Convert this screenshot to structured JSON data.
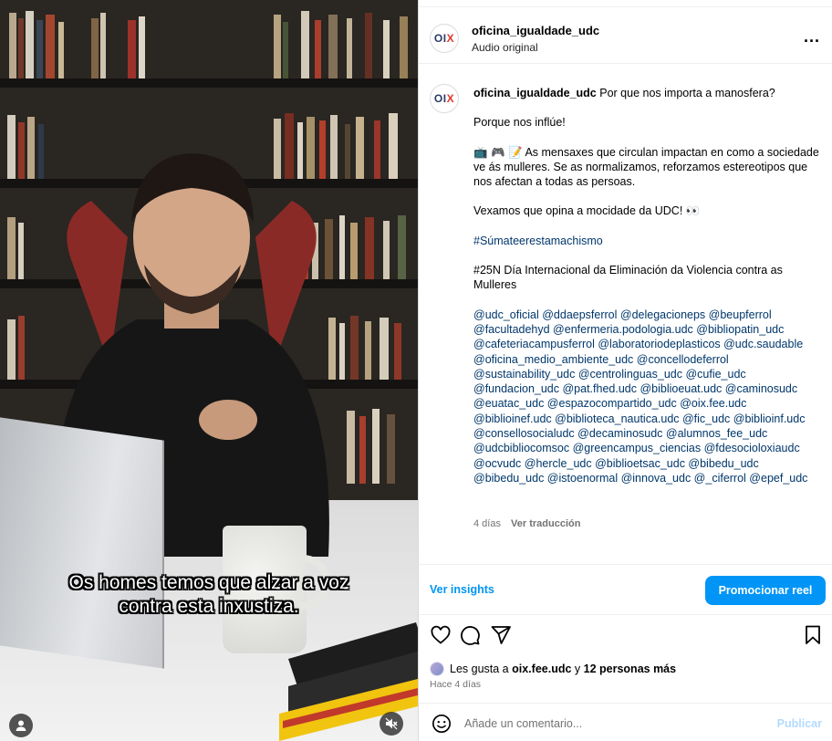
{
  "video": {
    "subtitle_lines": [
      "Os homes temos que alzar a voz",
      "contra esta inxustiza."
    ]
  },
  "post": {
    "username": "oficina_igualdade_udc",
    "audio_label": "Audio original",
    "avatar_text": "OIX",
    "more_label": "...",
    "caption": {
      "username": "oficina_igualdade_udc",
      "first_line": "Por que nos importa a manosfera?",
      "p2": "Porque nos inflúe!",
      "p3_emojis": "📺 🎮 📝",
      "p3": "As mensaxes que circulan impactan en como a sociedade ve ás mulleres. Se as normalizamos, reforzamos estereotipos que nos afectan a todas as persoas.",
      "p4": "Vexamos que opina a mocidade da UDC! 👀",
      "hashtag": "#Súmateerestamachismo",
      "p6": "#25N Día Internacional da Eliminación da Violencia contra as Mulleres",
      "mentions": "@udc_oficial @ddaepsferrol @delegacioneps @beupferrol @facultadehyd @enfermeria.podologia.udc @bibliopatin_udc @cafeteriacampusferrol @laboratoriodeplasticos @udc.saudable @oficina_medio_ambiente_udc @concellodeferrol @sustainability_udc @centrolinguas_udc @cufie_udc @fundacion_udc @pat.fhed.udc @biblioeuat.udc @caminosudc @euatac_udc @espazocompartido_udc @oix.fee.udc @biblioinef.udc @biblioteca_nautica.udc @fic_udc @biblioinf.udc @consellosocialudc @decaminosudc @alumnos_fee_udc @udcbibliocomsoc @greencampus_ciencias @fdesocioloxiaudc @ocvudc @hercle_udc @biblioetsac_udc @bibedu_udc @bibedu_udc @istoenormal @innova_udc @_ciferrol @epef_udc"
    },
    "time_ago": "4 días",
    "translate_label": "Ver traducción",
    "insights_label": "Ver insights",
    "promote_label": "Promocionar reel",
    "likes": {
      "prefix": "Les gusta a",
      "user": "oix.fee.udc",
      "connector": "y",
      "others": "12 personas más"
    },
    "posted_ago": "Hace 4 días",
    "comment_placeholder": "Añade un comentario...",
    "publish_label": "Publicar"
  },
  "colors": {
    "link": "#00376b",
    "accent": "#0095f6",
    "publish_disabled": "#b3dbff",
    "muted": "#737373"
  },
  "icons": [
    "user-tag-icon",
    "mute-icon",
    "heart-icon",
    "comment-bubble-icon",
    "paper-plane-icon",
    "bookmark-icon",
    "emoji-icon",
    "more-options-icon"
  ]
}
